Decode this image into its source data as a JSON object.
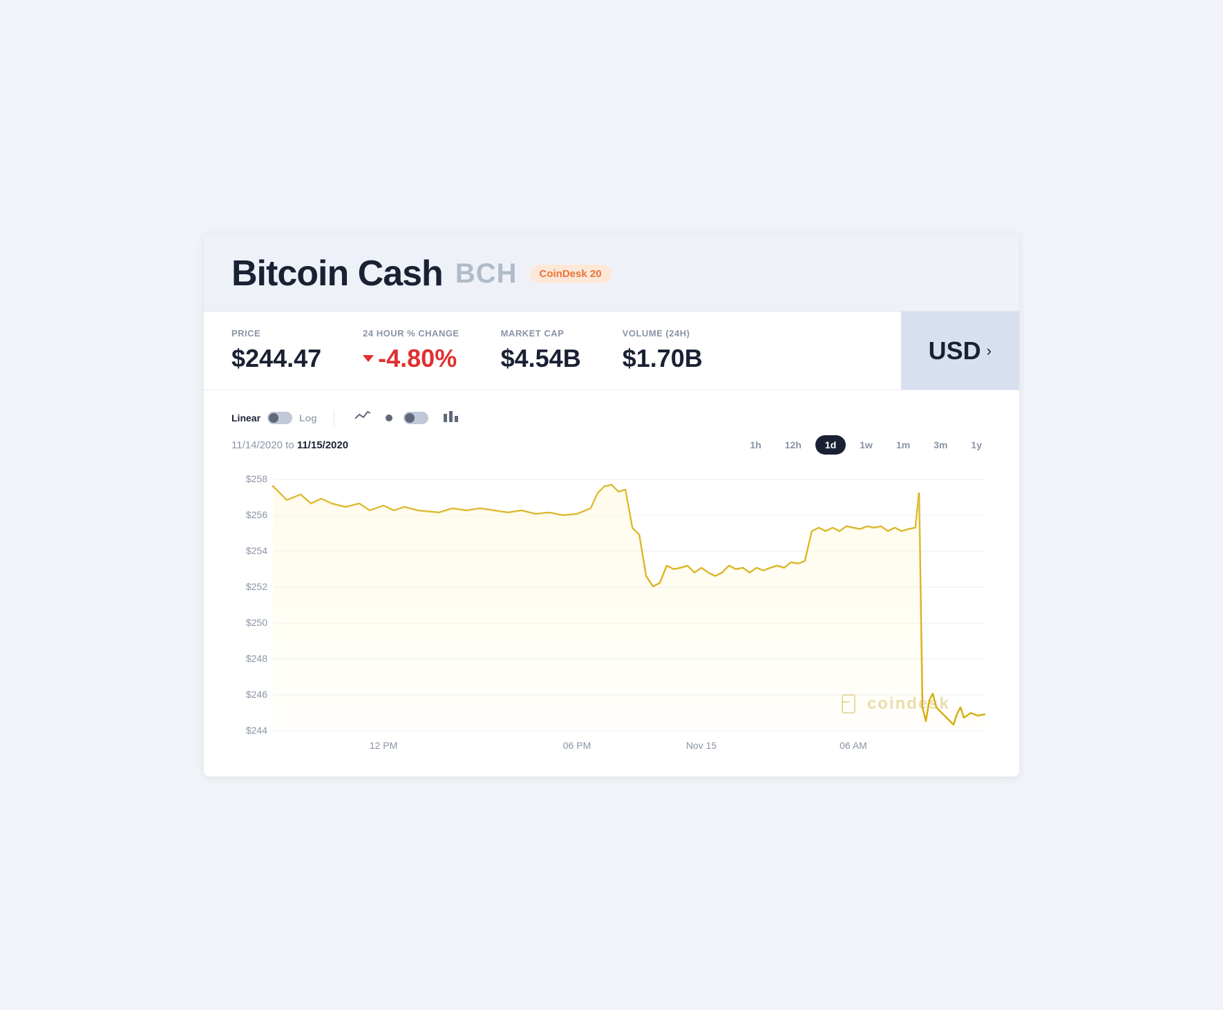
{
  "header": {
    "coin_name": "Bitcoin Cash",
    "coin_ticker": "BCH",
    "badge_label": "CoinDesk 20",
    "badge_color": "#e8733a",
    "badge_bg": "#fde8d8"
  },
  "stats": {
    "price_label": "PRICE",
    "price_value": "$244.47",
    "change_label": "24 HOUR % CHANGE",
    "change_value": "-4.80%",
    "change_negative": true,
    "market_cap_label": "MARKET CAP",
    "market_cap_value": "$4.54B",
    "volume_label": "VOLUME (24H)",
    "volume_value": "$1.70B",
    "currency": "USD"
  },
  "chart_controls": {
    "linear_label": "Linear",
    "log_label": "Log"
  },
  "date_range": {
    "from": "11/14/2020",
    "to": "11/15/2020",
    "to_label": "to"
  },
  "time_buttons": [
    {
      "label": "1h",
      "active": false
    },
    {
      "label": "12h",
      "active": false
    },
    {
      "label": "1d",
      "active": true
    },
    {
      "label": "1w",
      "active": false
    },
    {
      "label": "1m",
      "active": false
    },
    {
      "label": "3m",
      "active": false
    },
    {
      "label": "1y",
      "active": false
    }
  ],
  "x_axis_labels": [
    "12 PM",
    "06 PM",
    "Nov 15",
    "06 AM"
  ],
  "y_axis_labels": [
    "$258",
    "$256",
    "$254",
    "$252",
    "$250",
    "$248",
    "$246",
    "$244"
  ],
  "chart": {
    "fill_color": "#fffbea",
    "line_color": "#d4a800",
    "watermark": "coindesk"
  }
}
